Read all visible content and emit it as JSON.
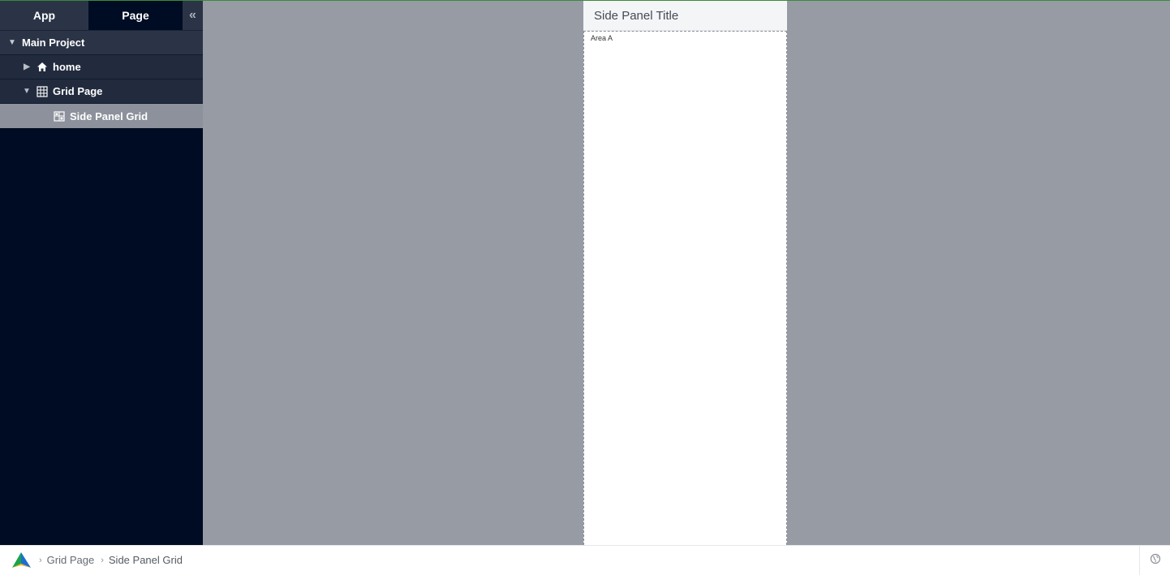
{
  "sidebar": {
    "tabs": {
      "app": "App",
      "page": "Page",
      "collapse": "«"
    },
    "tree": {
      "main_project": "Main Project",
      "home": "home",
      "grid_page": "Grid Page",
      "side_panel_grid": "Side Panel Grid"
    }
  },
  "canvas": {
    "panel_title": "Side Panel Title",
    "area_label": "Area A"
  },
  "footer": {
    "breadcrumb": [
      "Grid Page",
      "Side Panel Grid"
    ]
  },
  "icons": {
    "home": "home-icon",
    "grid": "grid-table-icon",
    "grid_component": "grid-component-icon",
    "globe": "globe-icon"
  },
  "colors": {
    "sidebar_bg": "#000c23",
    "selected_row": "#8c919b",
    "canvas_bg": "#979ba4"
  }
}
